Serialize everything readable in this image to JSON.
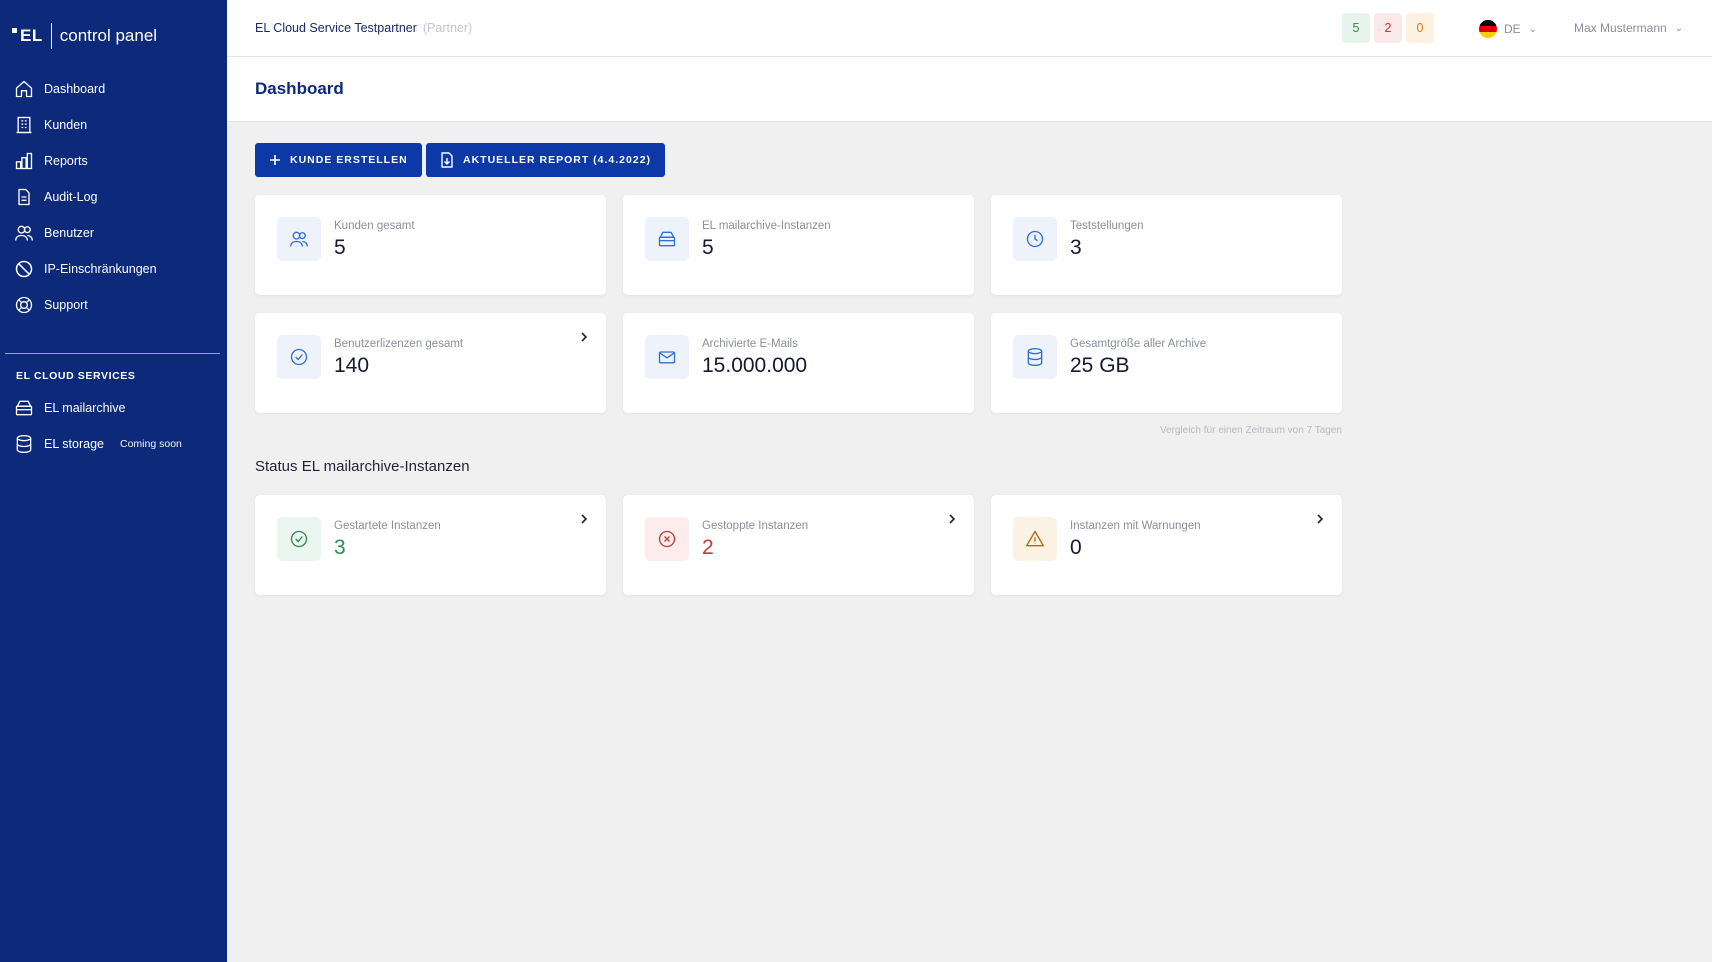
{
  "app": {
    "logo_mark": "EL",
    "logo_text": "control panel"
  },
  "sidebar": {
    "items": [
      {
        "label": "Dashboard",
        "icon": "home-icon"
      },
      {
        "label": "Kunden",
        "icon": "building-icon"
      },
      {
        "label": "Reports",
        "icon": "bar-chart-icon"
      },
      {
        "label": "Audit-Log",
        "icon": "document-icon"
      },
      {
        "label": "Benutzer",
        "icon": "users-icon"
      },
      {
        "label": "IP-Einschränkungen",
        "icon": "ban-icon"
      },
      {
        "label": "Support",
        "icon": "lifebuoy-icon"
      }
    ],
    "section_title": "EL CLOUD SERVICES",
    "services": [
      {
        "label": "EL mailarchive",
        "icon": "archive-icon",
        "tag": ""
      },
      {
        "label": "EL storage",
        "icon": "database-icon",
        "tag": "Coming soon"
      }
    ]
  },
  "topbar": {
    "org_name": "EL Cloud Service Testpartner",
    "org_role": "(Partner)",
    "badges": [
      "5",
      "2",
      "0"
    ],
    "language": "DE",
    "user_name": "Max Mustermann"
  },
  "header": {
    "title": "Dashboard"
  },
  "actions": {
    "create_customer": "KUNDE ERSTELLEN",
    "current_report": "AKTUELLER REPORT (4.4.2022)"
  },
  "stats": [
    {
      "label": "Kunden gesamt",
      "value": "5"
    },
    {
      "label": "EL mailarchive-Instanzen",
      "value": "5"
    },
    {
      "label": "Teststellungen",
      "value": "3"
    },
    {
      "label": "Benutzerlizenzen gesamt",
      "value": "140"
    },
    {
      "label": "Archivierte E-Mails",
      "value": "15.000.000"
    },
    {
      "label": "Gesamtgröße aller Archive",
      "value": "25 GB"
    }
  ],
  "comparison_note": "Vergleich für einen Zeitraum von 7 Tagen",
  "status": {
    "title": "Status EL mailarchive-Instanzen",
    "cards": [
      {
        "label": "Gestartete Instanzen",
        "value": "3"
      },
      {
        "label": "Gestoppte Instanzen",
        "value": "2"
      },
      {
        "label": "Instanzen mit Warnungen",
        "value": "0"
      }
    ]
  },
  "colors": {
    "sidebar": "#0d2a7a",
    "primary_button": "#0d39a8",
    "success": "#2e8a4f",
    "danger": "#c23a3a",
    "warning": "#d97b16"
  }
}
